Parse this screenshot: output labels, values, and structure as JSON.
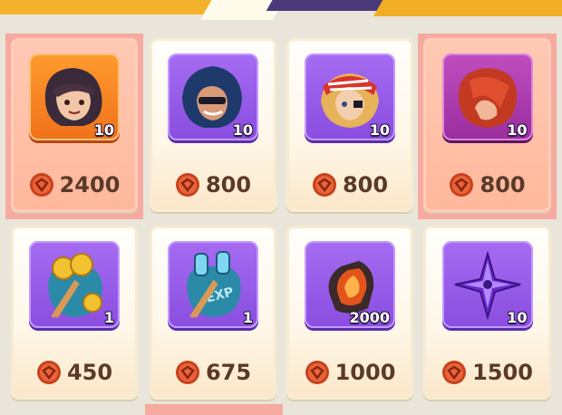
{
  "shop": {
    "items": [
      {
        "name": "hero-hood-fragment",
        "quantity": "10",
        "price": "2400",
        "highlighted": true,
        "tile": "orange"
      },
      {
        "name": "hero-blue-hood-fragment",
        "quantity": "10",
        "price": "800",
        "highlighted": false,
        "tile": "purple"
      },
      {
        "name": "hero-pirate-fragment",
        "quantity": "10",
        "price": "800",
        "highlighted": false,
        "tile": "purple"
      },
      {
        "name": "hero-redhair-fragment",
        "quantity": "10",
        "price": "800",
        "highlighted": true,
        "tile": "magenta"
      },
      {
        "name": "gold-bag",
        "quantity": "1",
        "price": "450",
        "highlighted": false,
        "tile": "purple"
      },
      {
        "name": "exp-potion-bag",
        "quantity": "1",
        "price": "675",
        "highlighted": false,
        "tile": "purple"
      },
      {
        "name": "fire-crystal",
        "quantity": "2000",
        "price": "1000",
        "highlighted": false,
        "tile": "purple"
      },
      {
        "name": "shuriken",
        "quantity": "10",
        "price": "1500",
        "highlighted": false,
        "tile": "purple"
      }
    ]
  },
  "colors": {
    "coin": "#d9502a",
    "price_text": "#5a3a28",
    "tile_purple": "#9a5ae8"
  }
}
